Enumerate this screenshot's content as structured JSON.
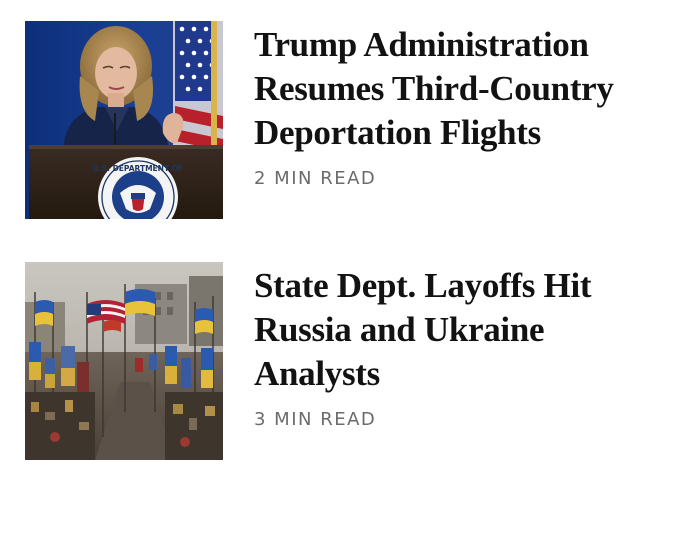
{
  "articles": [
    {
      "headline": "Trump Administration Resumes Third-Country Deportation Flights",
      "read_time": "2 MIN READ",
      "image_seal_text": "U.S. DEPARTMENT OF",
      "image_icon": "dhs-press-briefing-photo"
    },
    {
      "headline": "State Dept. Layoffs Hit Russia and Ukraine Analysts",
      "read_time": "3 MIN READ",
      "image_icon": "memorial-flags-photo"
    }
  ],
  "colors": {
    "headline": "#121212",
    "read_time": "#6b6b6b",
    "background": "#ffffff"
  }
}
